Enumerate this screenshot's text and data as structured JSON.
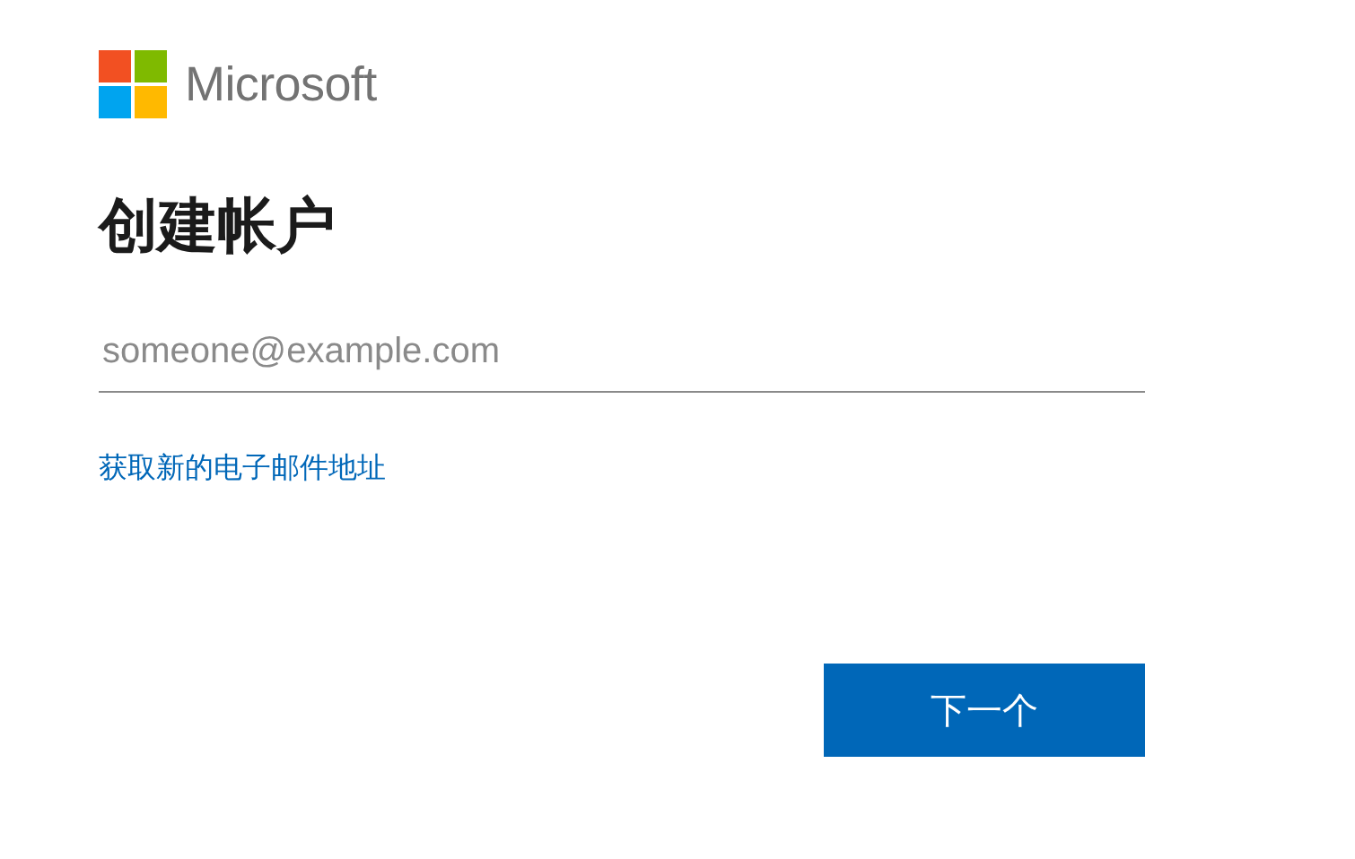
{
  "brand": {
    "name": "Microsoft"
  },
  "title": "创建帐户",
  "email_field": {
    "placeholder": "someone@example.com"
  },
  "link": "获取新的电子邮件地址",
  "next_button": "下一个"
}
